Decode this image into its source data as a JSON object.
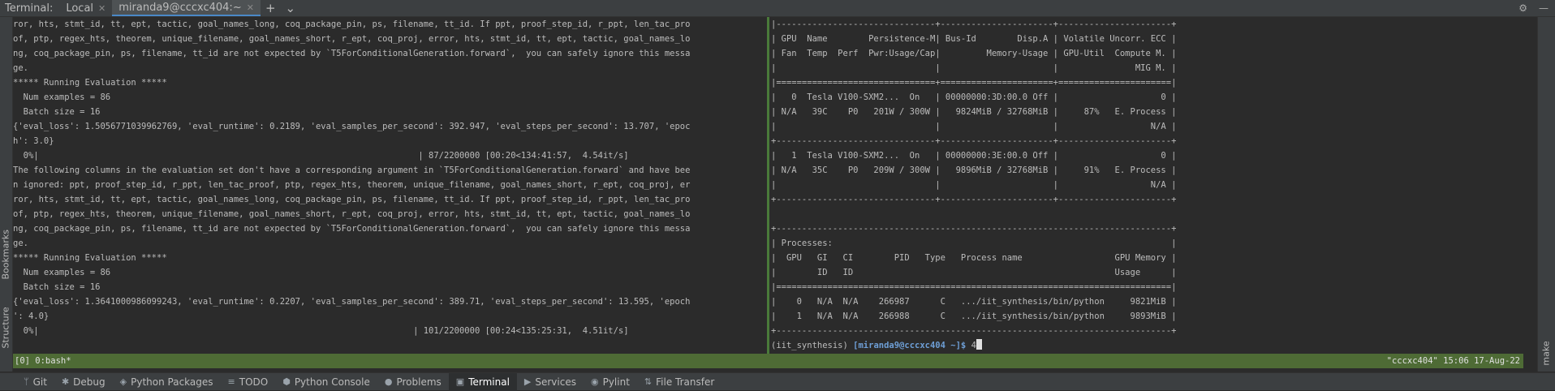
{
  "topbar": {
    "label": "Terminal:",
    "tabs": [
      {
        "label": "Local"
      },
      {
        "label": "miranda9@cccxc404:~"
      }
    ],
    "add_glyph": "+",
    "dropdown_glyph": "⌄",
    "settings_glyph": "⚙",
    "minimize_glyph": "—"
  },
  "left_strip": {
    "bookmarks": "Bookmarks",
    "structure": "Structure"
  },
  "right_strip": {
    "make": "make"
  },
  "left_pane": {
    "lines": [
      "ror, hts, stmt_id, tt, ept, tactic, goal_names_long, coq_package_pin, ps, filename, tt_id. If ppt, proof_step_id, r_ppt, len_tac_pro",
      "of, ptp, regex_hts, theorem, unique_filename, goal_names_short, r_ept, coq_proj, error, hts, stmt_id, tt, ept, tactic, goal_names_lo",
      "ng, coq_package_pin, ps, filename, tt_id are not expected by `T5ForConditionalGeneration.forward`,  you can safely ignore this messa",
      "ge.",
      "***** Running Evaluation *****",
      "  Num examples = 86",
      "  Batch size = 16",
      "{'eval_loss': 1.5056771039962769, 'eval_runtime': 0.2189, 'eval_samples_per_second': 392.947, 'eval_steps_per_second': 13.707, 'epoc",
      "h': 3.0}",
      "  0%|                                                                          | 87/2200000 [00:20<134:41:57,  4.54it/s]",
      "The following columns in the evaluation set don't have a corresponding argument in `T5ForConditionalGeneration.forward` and have bee",
      "n ignored: ppt, proof_step_id, r_ppt, len_tac_proof, ptp, regex_hts, theorem, unique_filename, goal_names_short, r_ept, coq_proj, er",
      "ror, hts, stmt_id, tt, ept, tactic, goal_names_long, coq_package_pin, ps, filename, tt_id. If ppt, proof_step_id, r_ppt, len_tac_pro",
      "of, ptp, regex_hts, theorem, unique_filename, goal_names_short, r_ept, coq_proj, error, hts, stmt_id, tt, ept, tactic, goal_names_lo",
      "ng, coq_package_pin, ps, filename, tt_id are not expected by `T5ForConditionalGeneration.forward`,  you can safely ignore this messa",
      "ge.",
      "***** Running Evaluation *****",
      "  Num examples = 86",
      "  Batch size = 16",
      "{'eval_loss': 1.3641000986099243, 'eval_runtime': 0.2207, 'eval_samples_per_second': 389.71, 'eval_steps_per_second': 13.595, 'epoch",
      "': 4.0}",
      "  0%|                                                                         | 101/2200000 [00:24<135:25:31,  4.51it/s]"
    ]
  },
  "right_pane": {
    "lines": [
      "|-------------------------------+----------------------+----------------------+",
      "| GPU  Name        Persistence-M| Bus-Id        Disp.A | Volatile Uncorr. ECC |",
      "| Fan  Temp  Perf  Pwr:Usage/Cap|         Memory-Usage | GPU-Util  Compute M. |",
      "|                               |                      |               MIG M. |",
      "|===============================+======================+======================|",
      "|   0  Tesla V100-SXM2...  On   | 00000000:3D:00.0 Off |                    0 |",
      "| N/A   39C    P0   201W / 300W |   9824MiB / 32768MiB |     87%   E. Process |",
      "|                               |                      |                  N/A |",
      "+-------------------------------+----------------------+----------------------+",
      "|   1  Tesla V100-SXM2...  On   | 00000000:3E:00.0 Off |                    0 |",
      "| N/A   35C    P0   209W / 300W |   9896MiB / 32768MiB |     91%   E. Process |",
      "|                               |                      |                  N/A |",
      "+-------------------------------+----------------------+----------------------+",
      "",
      "+-----------------------------------------------------------------------------+",
      "| Processes:                                                                  |",
      "|  GPU   GI   CI        PID   Type   Process name                  GPU Memory |",
      "|        ID   ID                                                   Usage      |",
      "|=============================================================================|",
      "|    0   N/A  N/A    266987      C   .../iit_synthesis/bin/python     9821MiB |",
      "|    1   N/A  N/A    266988      C   .../iit_synthesis/bin/python     9893MiB |",
      "+-----------------------------------------------------------------------------+"
    ],
    "prompt_env": "(iit_synthesis) ",
    "prompt_user": "[miranda9@cccxc404 ~]$",
    "input_value": "4"
  },
  "statusline": {
    "left": "[0] 0:bash*",
    "right": "\"cccxc404\" 15:06 17-Aug-22"
  },
  "bottombar": {
    "items": [
      {
        "label": "Git",
        "icon": "branch-icon",
        "glyph": "ᛘ"
      },
      {
        "label": "Debug",
        "icon": "bug-icon",
        "glyph": "✱"
      },
      {
        "label": "Python Packages",
        "icon": "packages-icon",
        "glyph": "◈"
      },
      {
        "label": "TODO",
        "icon": "list-icon",
        "glyph": "≡"
      },
      {
        "label": "Python Console",
        "icon": "python-icon",
        "glyph": "⬢"
      },
      {
        "label": "Problems",
        "icon": "info-icon",
        "glyph": "●"
      },
      {
        "label": "Terminal",
        "icon": "terminal-icon",
        "glyph": "▣"
      },
      {
        "label": "Services",
        "icon": "play-icon",
        "glyph": "▶"
      },
      {
        "label": "Pylint",
        "icon": "pylint-icon",
        "glyph": "◉"
      },
      {
        "label": "File Transfer",
        "icon": "transfer-icon",
        "glyph": "⇅"
      }
    ],
    "active_index": 6
  },
  "colors": {
    "accent": "#4a88c7",
    "status_green": "#4e6b35",
    "prompt_blue": "#6e9fd6"
  }
}
